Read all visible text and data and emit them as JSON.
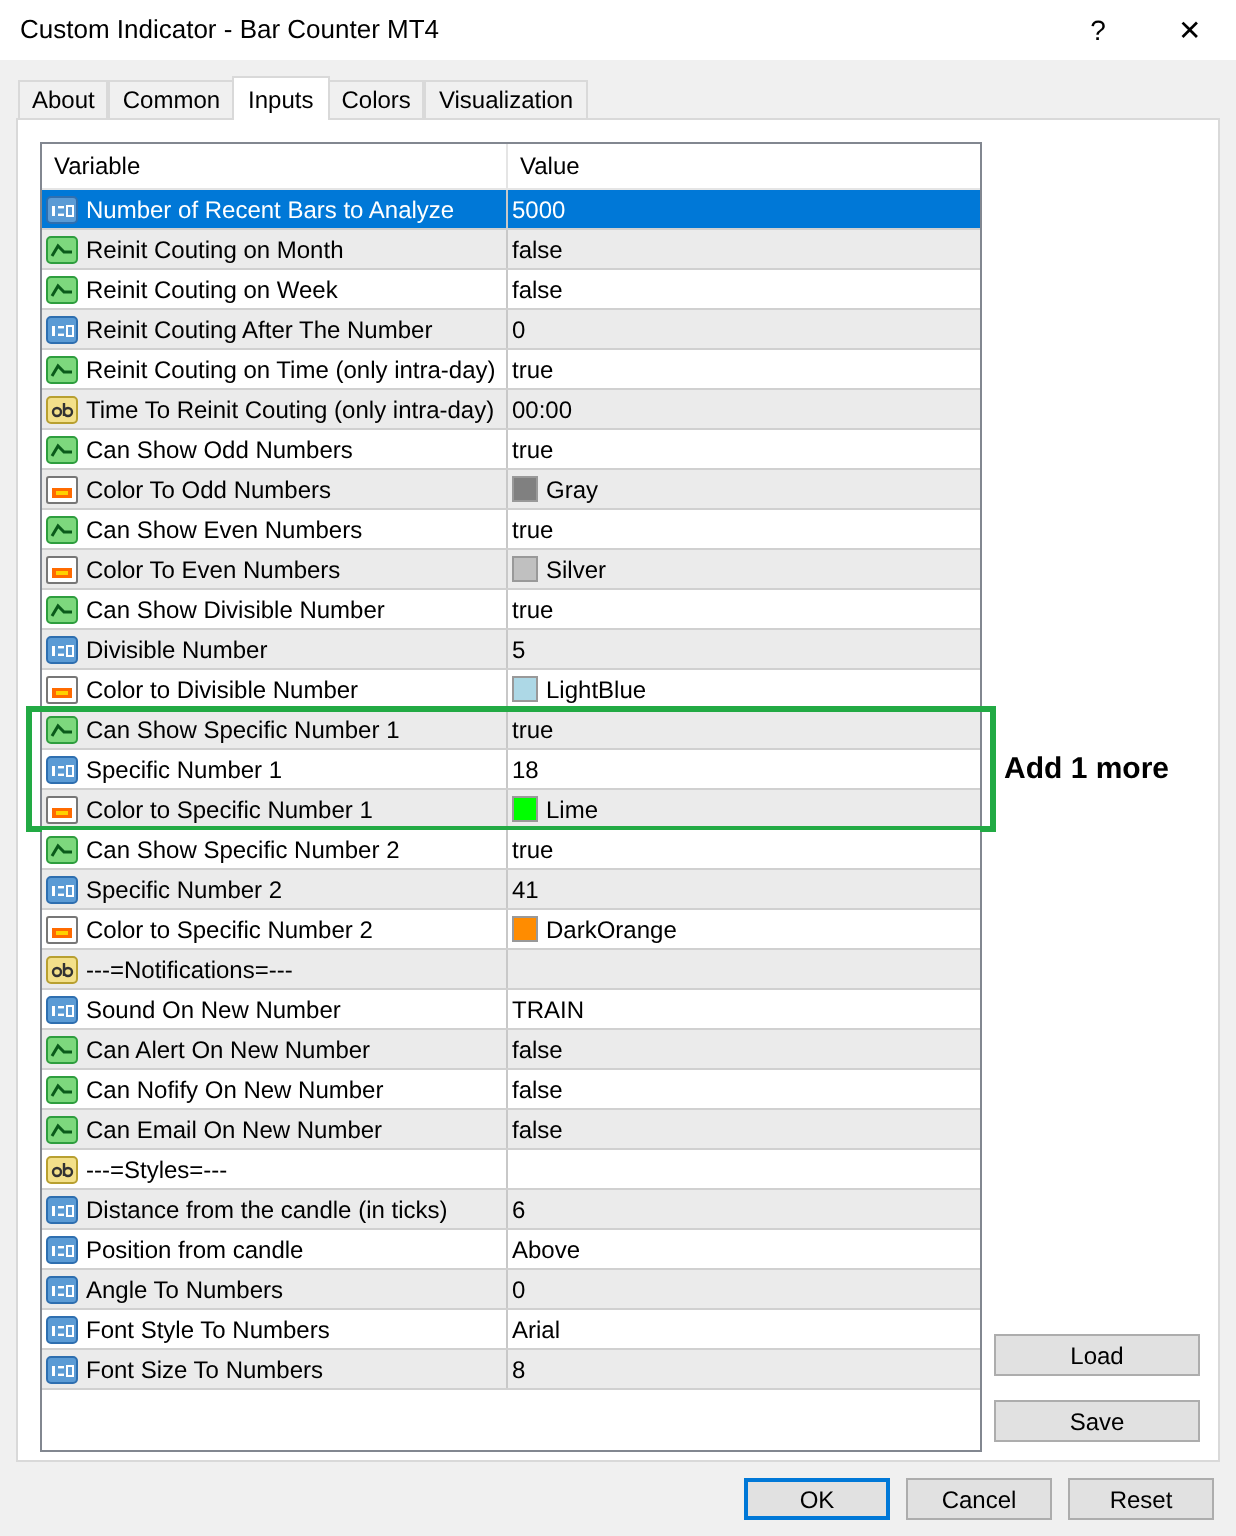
{
  "window": {
    "title": "Custom Indicator - Bar Counter MT4",
    "buttons": [
      "?",
      "✕"
    ]
  },
  "tabs": [
    {
      "label": "About",
      "selected": false
    },
    {
      "label": "Common",
      "selected": false
    },
    {
      "label": "Inputs",
      "selected": true
    },
    {
      "label": "Colors",
      "selected": false
    },
    {
      "label": "Visualization",
      "selected": false
    }
  ],
  "table": {
    "columns": [
      "Variable",
      "Value"
    ],
    "sections": [
      {
        "highlighted": false,
        "rows": [
          {
            "kind": "number",
            "variable": "Number of Recent Bars to Analyze",
            "value": "5000",
            "selected": true
          },
          {
            "kind": "bool",
            "variable": "Reinit Couting on Month",
            "value": "false",
            "selected": false
          },
          {
            "kind": "bool",
            "variable": "Reinit Couting on Week",
            "value": "false",
            "selected": false
          },
          {
            "kind": "number",
            "variable": "Reinit Couting After The Number",
            "value": "0",
            "selected": false
          },
          {
            "kind": "bool",
            "variable": "Reinit Couting on Time (only intra-day)",
            "value": "true",
            "selected": false
          },
          {
            "kind": "string",
            "variable": "Time To Reinit Couting (only intra-day)",
            "value": "00:00",
            "selected": false
          },
          {
            "kind": "bool",
            "variable": "Can Show Odd Numbers",
            "value": "true",
            "selected": false
          },
          {
            "kind": "color",
            "variable": "Color To Odd Numbers",
            "value": "Gray",
            "color": "#808080",
            "selected": false
          },
          {
            "kind": "bool",
            "variable": "Can Show Even Numbers",
            "value": "true",
            "selected": false
          },
          {
            "kind": "color",
            "variable": "Color To Even Numbers",
            "value": "Silver",
            "color": "#c0c0c0",
            "selected": false
          },
          {
            "kind": "bool",
            "variable": "Can Show Divisible Number",
            "value": "true",
            "selected": false
          },
          {
            "kind": "number",
            "variable": "Divisible Number",
            "value": "5",
            "selected": false
          },
          {
            "kind": "color",
            "variable": "Color to Divisible Number",
            "value": "LightBlue",
            "color": "#add8e6",
            "selected": false
          }
        ]
      },
      {
        "highlighted": true,
        "note": "Add 1 more",
        "rows": [
          {
            "kind": "bool",
            "variable": "Can Show Specific Number 1",
            "value": "true",
            "selected": false
          },
          {
            "kind": "number",
            "variable": "Specific Number 1",
            "value": "18",
            "selected": false
          },
          {
            "kind": "color",
            "variable": "Color to Specific Number 1",
            "value": "Lime",
            "color": "#00ff00",
            "selected": false
          }
        ]
      },
      {
        "highlighted": false,
        "rows": [
          {
            "kind": "bool",
            "variable": "Can Show Specific Number 2",
            "value": "true",
            "selected": false
          },
          {
            "kind": "number",
            "variable": "Specific Number 2",
            "value": "41",
            "selected": false
          },
          {
            "kind": "color",
            "variable": "Color to Specific Number 2",
            "value": "DarkOrange",
            "color": "#ff8c00",
            "selected": false
          },
          {
            "kind": "string",
            "variable": "---=Notifications=---",
            "selected": false
          },
          {
            "kind": "number",
            "variable": "Sound On New Number",
            "value": "TRAIN",
            "selected": false
          },
          {
            "kind": "bool",
            "variable": "Can Alert On New Number",
            "value": "false",
            "selected": false
          },
          {
            "kind": "bool",
            "variable": "Can Nofify On New Number",
            "value": "false",
            "selected": false
          },
          {
            "kind": "bool",
            "variable": "Can Email On New Number",
            "value": "false",
            "selected": false
          },
          {
            "kind": "string",
            "variable": "---=Styles=---",
            "selected": false
          },
          {
            "kind": "number",
            "variable": "Distance from the candle (in ticks)",
            "value": "6",
            "selected": false
          },
          {
            "kind": "number",
            "variable": "Position from candle",
            "value": "Above",
            "selected": false
          },
          {
            "kind": "number",
            "variable": "Angle To Numbers",
            "value": "0",
            "selected": false
          },
          {
            "kind": "number",
            "variable": "Font Style To Numbers",
            "value": "Arial",
            "selected": false
          },
          {
            "kind": "number",
            "variable": "Font Size To Numbers",
            "value": "8",
            "selected": false
          }
        ]
      }
    ]
  },
  "side_buttons": [
    "Load",
    "Save"
  ],
  "dialog_buttons": [
    {
      "label": "OK",
      "default": true
    },
    {
      "label": "Cancel",
      "default": false
    },
    {
      "label": "Reset",
      "default": false
    }
  ]
}
